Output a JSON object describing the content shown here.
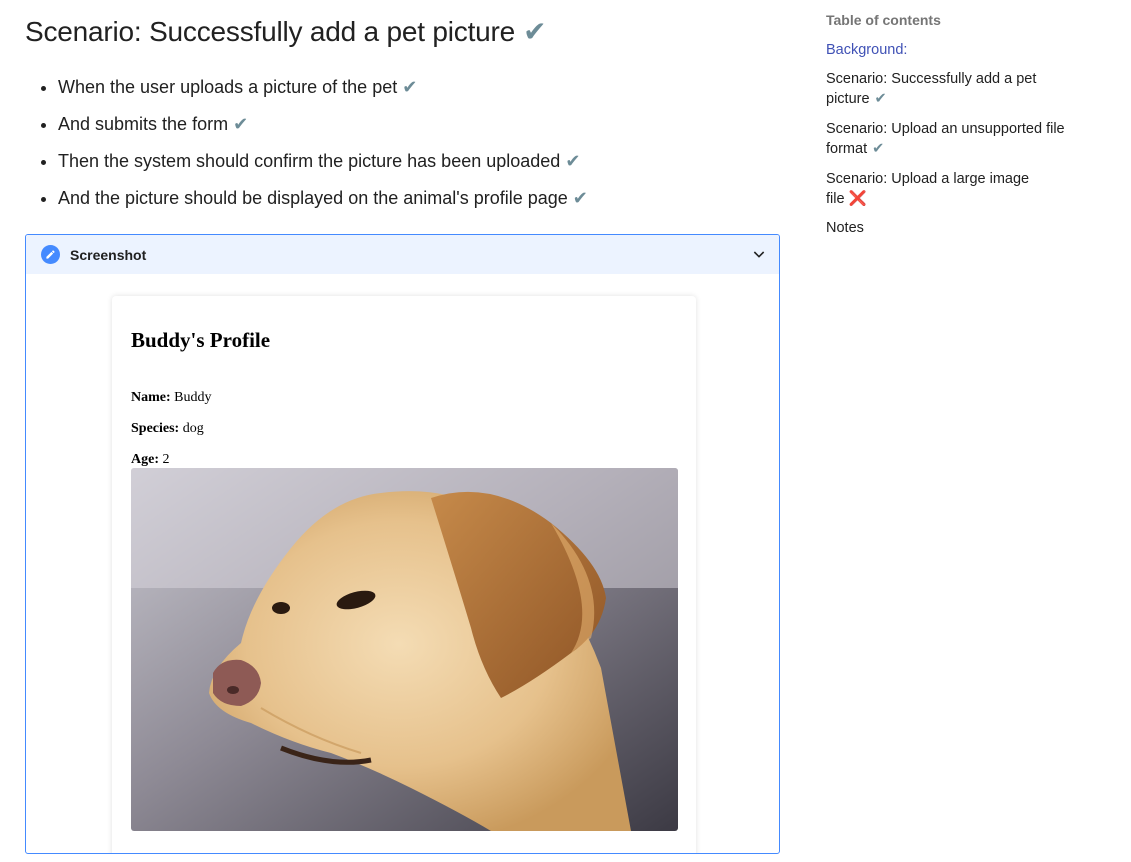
{
  "scenario": {
    "title": "Scenario: Successfully add a pet picture",
    "title_status": "✔",
    "steps": [
      {
        "text": "When the user uploads a picture of the pet",
        "status": "✔"
      },
      {
        "text": "And submits the form",
        "status": "✔"
      },
      {
        "text": "Then the system should confirm the picture has been uploaded",
        "status": "✔"
      },
      {
        "text": "And the picture should be displayed on the animal's profile page",
        "status": "✔"
      }
    ]
  },
  "admonition": {
    "title": "Screenshot",
    "icon": "pencil-icon",
    "expanded": true
  },
  "profile": {
    "heading": "Buddy's Profile",
    "name_label": "Name:",
    "name_value": "Buddy",
    "species_label": "Species:",
    "species_value": "dog",
    "age_label": "Age:",
    "age_value": "2",
    "photo": "dog-photo"
  },
  "toc": {
    "title": "Table of contents",
    "items": [
      {
        "label": "Background:",
        "status": ""
      },
      {
        "label": "Scenario: Successfully add a pet picture",
        "status": "✔"
      },
      {
        "label": "Scenario: Upload an unsupported file format",
        "status": "✔"
      },
      {
        "label": "Scenario: Upload a large image file",
        "status": "❌"
      },
      {
        "label": "Notes",
        "status": ""
      }
    ]
  },
  "colors": {
    "accent": "#448aff",
    "check": "#6d8c97",
    "cross": "#e53935",
    "toc_active": "#3f51b5"
  }
}
